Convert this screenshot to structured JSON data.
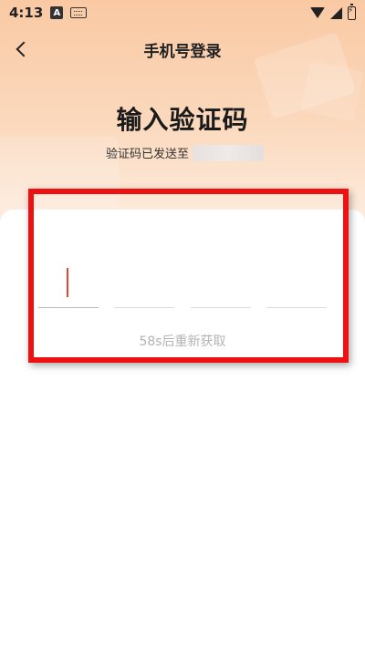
{
  "status_bar": {
    "time": "4:13",
    "app_icon_letter": "A",
    "icons": [
      "app-notification-icon",
      "keyboard-icon",
      "wifi-icon",
      "signal-icon",
      "battery-charging-icon"
    ]
  },
  "nav": {
    "back_icon": "chevron-left-icon",
    "title": "手机号登录"
  },
  "main": {
    "heading": "输入验证码",
    "sent_label": "验证码已发送至"
  },
  "code_input": {
    "cells": [
      "",
      "",
      "",
      ""
    ],
    "active_index": 0,
    "cursor_color": "#e8452c"
  },
  "resend": {
    "label": "58s后重新获取"
  },
  "colors": {
    "header_gradient_top": "#f9c9a3",
    "highlight": "#ee1111",
    "resend_text": "#b3b3b3"
  }
}
